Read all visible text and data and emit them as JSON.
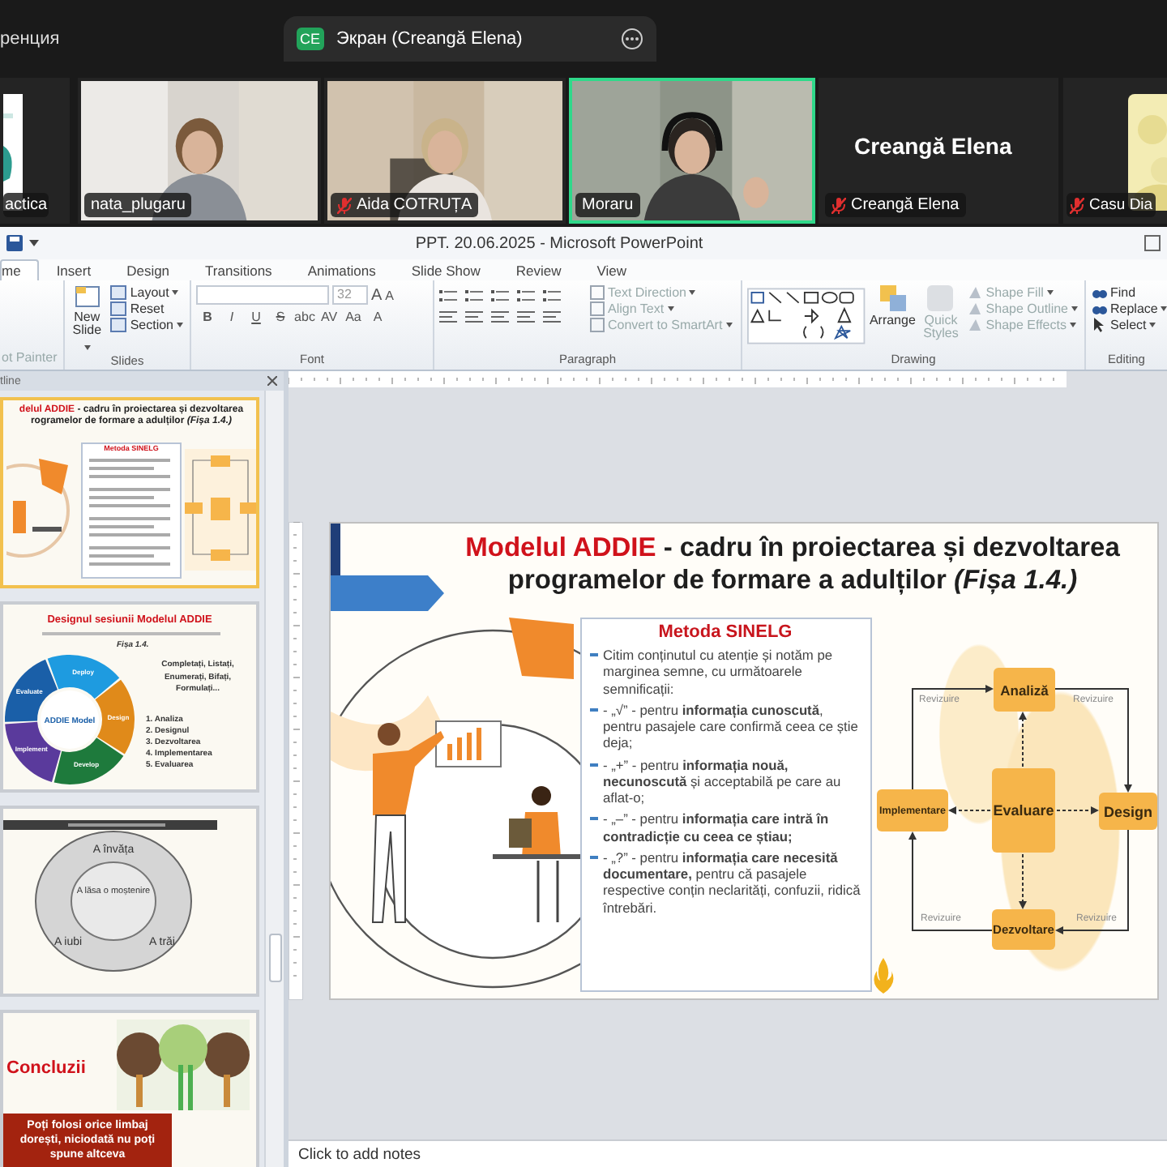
{
  "meeting": {
    "tabs": [
      {
        "label": "ренция",
        "selected": false
      },
      {
        "badge": "CE",
        "label": "Экран (Creangă Elena)",
        "selected": true
      }
    ],
    "participants": [
      {
        "kind": "logo",
        "name": "actica",
        "muted": false,
        "speaking": false
      },
      {
        "kind": "video",
        "name": "nata_plugaru",
        "muted": false,
        "speaking": false
      },
      {
        "kind": "video",
        "name": "Aida COTRUȚA",
        "muted": true,
        "speaking": false
      },
      {
        "kind": "video",
        "name": "Moraru",
        "muted": false,
        "speaking": true
      },
      {
        "kind": "name",
        "display_name": "Creangă Elena",
        "name": "Creangă Elena",
        "muted": true,
        "speaking": false
      },
      {
        "name": "Casu Dia",
        "muted": true,
        "speaking": false
      }
    ]
  },
  "powerpoint": {
    "title": "PPT. 20.06.2025 - Microsoft PowerPoint",
    "ribbon_tabs": [
      {
        "label": "me",
        "selected": true
      },
      {
        "label": "Insert",
        "selected": false
      },
      {
        "label": "Design",
        "selected": false
      },
      {
        "label": "Transitions",
        "selected": false
      },
      {
        "label": "Animations",
        "selected": false
      },
      {
        "label": "Slide Show",
        "selected": false
      },
      {
        "label": "Review",
        "selected": false
      },
      {
        "label": "View",
        "selected": false
      }
    ],
    "ribbon": {
      "clipboard": {
        "label": "ot Painter",
        "disabled": true
      },
      "slides": {
        "new_slide": "New Slide",
        "items": [
          "Layout",
          "Reset",
          "Section"
        ],
        "group": "Slides"
      },
      "font": {
        "size": "32",
        "grow_shrink": [
          "A",
          "A"
        ],
        "buttons": [
          "B",
          "I",
          "U",
          "S",
          "abc",
          "AV",
          "Aa",
          "A"
        ],
        "group": "Font"
      },
      "paragraph": {
        "items": [
          {
            "label": "Text Direction",
            "disabled": true
          },
          {
            "label": "Align Text",
            "disabled": true
          },
          {
            "label": "Convert to SmartArt",
            "disabled": true
          }
        ],
        "group": "Paragraph"
      },
      "drawing": {
        "arrange": "Arrange",
        "quick_styles": {
          "label": "Quick Styles",
          "disabled": true
        },
        "items": [
          {
            "label": "Shape Fill",
            "disabled": true
          },
          {
            "label": "Shape Outline",
            "disabled": true
          },
          {
            "label": "Shape Effects",
            "disabled": true
          }
        ],
        "group": "Drawing"
      },
      "editing": {
        "items": [
          "Find",
          "Replace",
          "Select"
        ],
        "group": "Editing"
      }
    },
    "outline_tab": "tline",
    "thumbnails": [
      {
        "kind": "addie",
        "selected": true,
        "title": "**delul ADDIE** - cadru în proiectarea și dezvoltarea rogramelor de formare a adulților *(Fișa 1.4.)*",
        "box_title": "Metoda SINELG"
      },
      {
        "kind": "design",
        "selected": false,
        "title": "Designul sesiunii Modelul ADDIE",
        "ref": "Fișa 1.4.",
        "wheel_center": "ADDIE Model",
        "segments": [
          "Deploy",
          "Design",
          "Develop",
          "Implement",
          "Evaluate"
        ],
        "prompt": "Completați, Listați, Enumerați, Bifați, Formulați...",
        "steps": [
          "1. Analiza",
          "2. Designul",
          "3. Dezvoltarea",
          "4. Implementarea",
          "5. Evaluarea"
        ]
      },
      {
        "kind": "wheel",
        "selected": false,
        "rings": [
          "A învăța",
          "A lăsa o moștenire",
          "A iubi",
          "A trăi"
        ]
      },
      {
        "kind": "conclusion",
        "selected": false,
        "title": "Concluzii",
        "quote": "Poți folosi orice limbaj dorești, niciodată nu poți spune altceva"
      }
    ],
    "slide": {
      "title": "**Modelul ADDIE** - cadru în proiectarea și dezvoltarea programelor de formare a adulților *(Fișa 1.4.)*",
      "method": {
        "title": "Metoda SINELG",
        "bullets": [
          "Citim conținutul cu atenție și notăm pe marginea semne, cu următoarele semnificații:",
          "- „√” - pentru **informația cunoscută**, pentru pasajele care confirmă ceea ce știe deja;",
          "- „+” - pentru **informația nouă, necunoscută** și acceptabilă pe care au aflat-o;",
          "- „–” - pentru **informația care intră în contradicție cu ceea ce știau;**",
          "- „?” - pentru **informația care necesită documentare,** pentru că pasajele respective conțin neclarități, confuzii, ridică întrebări."
        ]
      },
      "diagram": {
        "nodes": [
          "Analiză",
          "Implementare",
          "Evaluare",
          "Design",
          "Dezvoltare"
        ],
        "edge_labels": [
          "Revizuire",
          "Revizuire",
          "Revizuire",
          "Revizuire"
        ]
      }
    },
    "notes_placeholder": "Click to add notes"
  }
}
